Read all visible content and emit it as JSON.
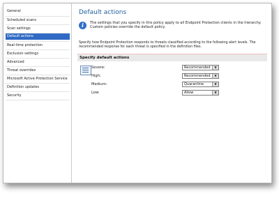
{
  "nav": {
    "items": [
      {
        "label": "General",
        "selected": false
      },
      {
        "label": "Scheduled scans",
        "selected": false
      },
      {
        "label": "Scan settings",
        "selected": false
      },
      {
        "label": "Default actions",
        "selected": true
      },
      {
        "label": "Real-time protection",
        "selected": false
      },
      {
        "label": "Exclusion settings",
        "selected": false
      },
      {
        "label": "Advanced",
        "selected": false
      },
      {
        "label": "Threat overrides",
        "selected": false
      },
      {
        "label": "Microsoft Active Protection Service",
        "selected": false
      },
      {
        "label": "Definition updates",
        "selected": false
      },
      {
        "label": "Security",
        "selected": false
      }
    ]
  },
  "main": {
    "title": "Default actions",
    "info_line1": "The settings that you specify in this policy apply to all Endpoint Protection clients in the hierarchy.",
    "info_line2": "Custom policies override the default policy.",
    "desc_line1": "Specify how Endpoint Protection responds to threats classified according to the following alert levels. The",
    "desc_line2": "recommended response for each threat is specified in the definition files.",
    "section_header": "Specify default actions",
    "rows": [
      {
        "label": "Severe:",
        "value": "Recommended"
      },
      {
        "label": "High:",
        "value": "Recommended"
      },
      {
        "label": "Medium:",
        "value": "Quarantine"
      },
      {
        "label": "Low:",
        "value": "Allow"
      }
    ]
  },
  "icons": {
    "info": "info-icon",
    "threat": "threat-list-icon",
    "dropdown": "chevron-down-icon"
  },
  "colors": {
    "accent": "#316ac5",
    "title": "#1f5f9f"
  }
}
